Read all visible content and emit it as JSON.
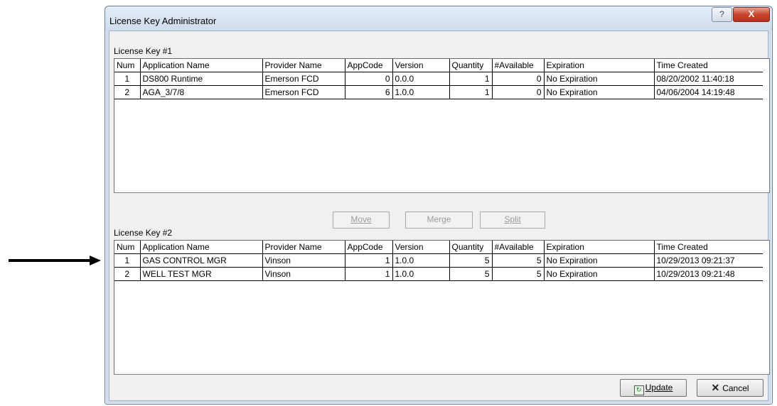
{
  "window": {
    "title": "License Key Administrator",
    "help_label": "?",
    "close_label": "X"
  },
  "key1": {
    "label": "License Key #1",
    "columns": [
      "Num",
      "Application Name",
      "Provider Name",
      "AppCode",
      "Version",
      "Quantity",
      "#Available",
      "Expiration",
      "Time Created"
    ],
    "rows": [
      [
        "1",
        "DS800 Runtime",
        "Emerson FCD",
        "0",
        "0.0.0",
        "1",
        "0",
        "No Expiration",
        "08/20/2002 11:40:18"
      ],
      [
        "2",
        "AGA_3/7/8",
        "Emerson FCD",
        "6",
        "1.0.0",
        "1",
        "0",
        "No Expiration",
        "04/06/2004 14:19:48"
      ]
    ]
  },
  "key2": {
    "label": "License Key #2",
    "columns": [
      "Num",
      "Application Name",
      "Provider Name",
      "AppCode",
      "Version",
      "Quantity",
      "#Available",
      "Expiration",
      "Time Created"
    ],
    "rows": [
      [
        "1",
        "GAS CONTROL MGR",
        "Vinson",
        "1",
        "1.0.0",
        "5",
        "5",
        "No Expiration",
        "10/29/2013 09:21:37"
      ],
      [
        "2",
        "WELL TEST MGR",
        "Vinson",
        "1",
        "1.0.0",
        "5",
        "5",
        "No Expiration",
        "10/29/2013 09:21:48"
      ]
    ]
  },
  "buttons": {
    "move": "Move",
    "merge": "Merge",
    "split": "Split",
    "update": "Update",
    "cancel": "Cancel"
  },
  "icons": {
    "update": "refresh-icon",
    "cancel": "x-icon",
    "pointer": "arrow-icon"
  }
}
